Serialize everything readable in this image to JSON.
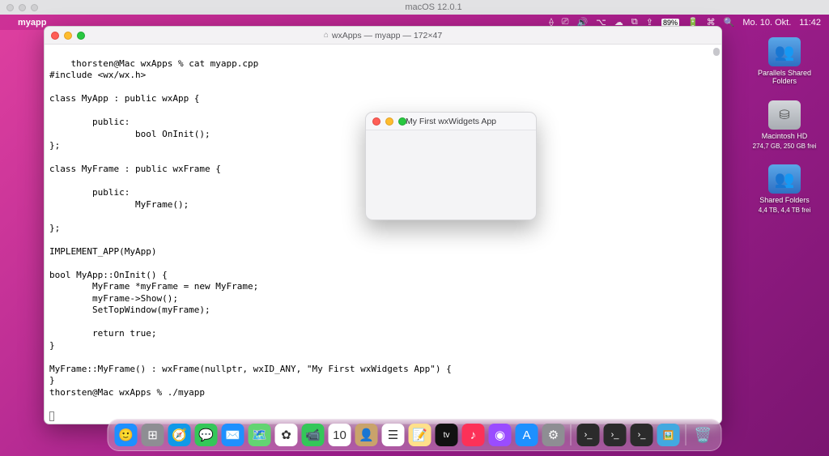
{
  "vm": {
    "title": "macOS 12.0.1"
  },
  "menubar": {
    "app_name": "myapp",
    "battery": "89%",
    "date": "Mo. 10. Okt.",
    "time": "11:42"
  },
  "desktop_icons": [
    {
      "label": "Parallels Shared Folders",
      "sub": "",
      "kind": "folder"
    },
    {
      "label": "Macintosh HD",
      "sub": "274,7 GB, 250 GB frei",
      "kind": "disk"
    },
    {
      "label": "Shared Folders",
      "sub": "4,4 TB, 4,4 TB frei",
      "kind": "folder"
    }
  ],
  "terminal": {
    "title": "wxApps — myapp — 172×47",
    "lines": [
      "thorsten@Mac wxApps % cat myapp.cpp",
      "#include <wx/wx.h>",
      "",
      "class MyApp : public wxApp {",
      "",
      "        public:",
      "                bool OnInit();",
      "};",
      "",
      "class MyFrame : public wxFrame {",
      "",
      "        public:",
      "                MyFrame();",
      "",
      "};",
      "",
      "IMPLEMENT_APP(MyApp)",
      "",
      "bool MyApp::OnInit() {",
      "        MyFrame *myFrame = new MyFrame;",
      "        myFrame->Show();",
      "        SetTopWindow(myFrame);",
      "",
      "        return true;",
      "}",
      "",
      "MyFrame::MyFrame() : wxFrame(nullptr, wxID_ANY, \"My First wxWidgets App\") {",
      "}",
      "thorsten@Mac wxApps % ./myapp"
    ]
  },
  "wx_window": {
    "title": "My First wxWidgets App"
  },
  "dock": {
    "apps": [
      {
        "name": "finder",
        "glyph": "🙂",
        "bg": "#1e90ff"
      },
      {
        "name": "launchpad",
        "glyph": "⊞",
        "bg": "#8e8e93"
      },
      {
        "name": "safari",
        "glyph": "🧭",
        "bg": "#1099e8"
      },
      {
        "name": "messages",
        "glyph": "💬",
        "bg": "#34c759"
      },
      {
        "name": "mail",
        "glyph": "✉️",
        "bg": "#1e90ff"
      },
      {
        "name": "maps",
        "glyph": "🗺️",
        "bg": "#63d472"
      },
      {
        "name": "photos",
        "glyph": "✿",
        "bg": "#ffffff"
      },
      {
        "name": "facetime",
        "glyph": "📹",
        "bg": "#34c759"
      },
      {
        "name": "calendar",
        "glyph": "10",
        "bg": "#ffffff"
      },
      {
        "name": "contacts",
        "glyph": "👤",
        "bg": "#c9a36b"
      },
      {
        "name": "reminders",
        "glyph": "☰",
        "bg": "#ffffff"
      },
      {
        "name": "notes",
        "glyph": "📝",
        "bg": "#ffe08a"
      },
      {
        "name": "tv",
        "glyph": "tv",
        "bg": "#111111"
      },
      {
        "name": "music",
        "glyph": "♪",
        "bg": "#fc3158"
      },
      {
        "name": "podcasts",
        "glyph": "◉",
        "bg": "#9a4cff"
      },
      {
        "name": "appstore",
        "glyph": "A",
        "bg": "#1e90ff"
      },
      {
        "name": "preferences",
        "glyph": "⚙︎",
        "bg": "#8e8e93"
      }
    ],
    "recent": [
      {
        "name": "terminal-recent-1",
        "glyph": "›_",
        "bg": "#2b2b2b"
      },
      {
        "name": "terminal-recent-2",
        "glyph": "›_",
        "bg": "#2b2b2b"
      },
      {
        "name": "terminal-recent-3",
        "glyph": "›_",
        "bg": "#2b2b2b"
      },
      {
        "name": "preview-recent",
        "glyph": "🖼️",
        "bg": "#42a9e0"
      }
    ]
  }
}
